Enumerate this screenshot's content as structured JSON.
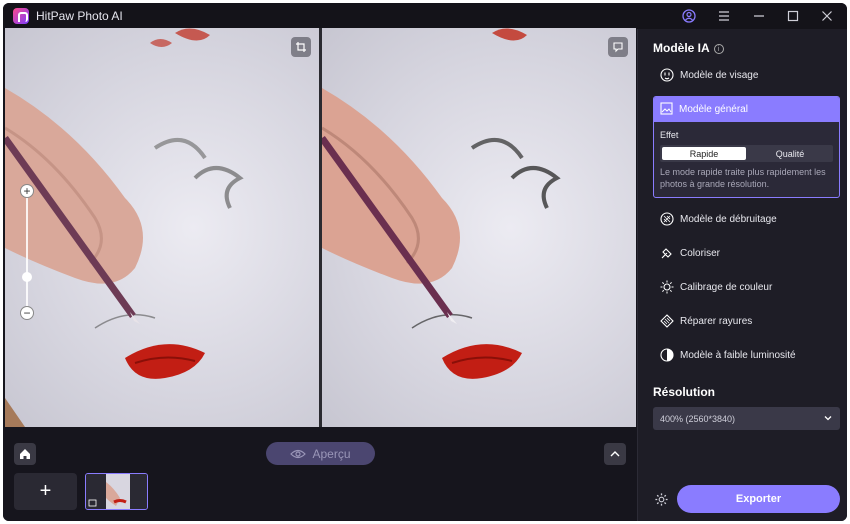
{
  "app": {
    "title": "HitPaw Photo AI"
  },
  "titlebar": {
    "icons": [
      "account-icon",
      "menu-icon",
      "minimize-icon",
      "maximize-icon",
      "close-icon"
    ]
  },
  "canvas": {
    "compare_icons": [
      "crop-icon",
      "feedback-icon"
    ]
  },
  "bottom": {
    "apercu_label": "Aperçu",
    "add_label": "+"
  },
  "panel": {
    "models_title": "Modèle IA",
    "models": [
      {
        "label": "Modèle de visage",
        "icon": "face-icon"
      },
      {
        "label": "Modèle général",
        "icon": "image-icon",
        "active": true
      },
      {
        "label": "Modèle de débruitage",
        "icon": "denoise-icon"
      },
      {
        "label": "Coloriser",
        "icon": "colorize-icon"
      },
      {
        "label": "Calibrage de couleur",
        "icon": "sun-icon"
      },
      {
        "label": "Réparer rayures",
        "icon": "scratch-icon"
      },
      {
        "label": "Modèle à faible luminosité",
        "icon": "half-circle-icon"
      }
    ],
    "effect": {
      "label": "Effet",
      "options": [
        "Rapide",
        "Qualité"
      ],
      "selected": "Rapide",
      "description": "Le mode rapide traite plus rapidement les photos à grande résolution."
    },
    "resolution_title": "Résolution",
    "resolution_value": "400% (2560*3840)",
    "export_label": "Exporter"
  },
  "colors": {
    "accent": "#8a7cff",
    "background": "#16151d",
    "panel": "#1e1d26"
  }
}
